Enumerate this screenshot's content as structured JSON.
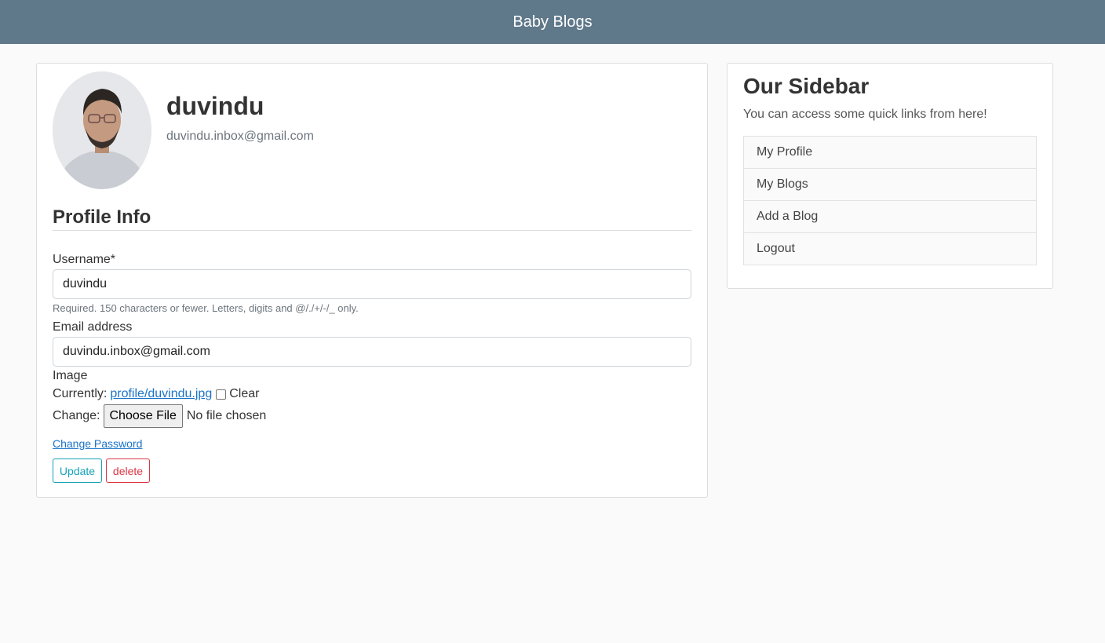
{
  "navbar": {
    "brand": "Baby Blogs"
  },
  "profile": {
    "username": "duvindu",
    "email": "duvindu.inbox@gmail.com"
  },
  "form": {
    "section_title": "Profile Info",
    "username_label": "Username*",
    "username_value": "duvindu",
    "username_help": "Required. 150 characters or fewer. Letters, digits and @/./+/-/_ only.",
    "email_label": "Email address",
    "email_value": "duvindu.inbox@gmail.com",
    "image_label": "Image",
    "currently_label": "Currently:",
    "current_file": "profile/duvindu.jpg",
    "clear_label": "Clear",
    "change_label": "Change:",
    "choose_file_button": "Choose File",
    "no_file_text": "No file chosen",
    "change_password_link": "Change Password",
    "update_button": "Update",
    "delete_button": "delete"
  },
  "sidebar": {
    "title": "Our Sidebar",
    "description": "You can access some quick links from here!",
    "items": [
      {
        "label": "My Profile"
      },
      {
        "label": "My Blogs"
      },
      {
        "label": "Add a Blog"
      },
      {
        "label": "Logout"
      }
    ]
  },
  "colors": {
    "navbar": "#5f788a",
    "link": "#1a73c9",
    "update_outline": "#17a2b8",
    "delete_outline": "#dc3545"
  }
}
